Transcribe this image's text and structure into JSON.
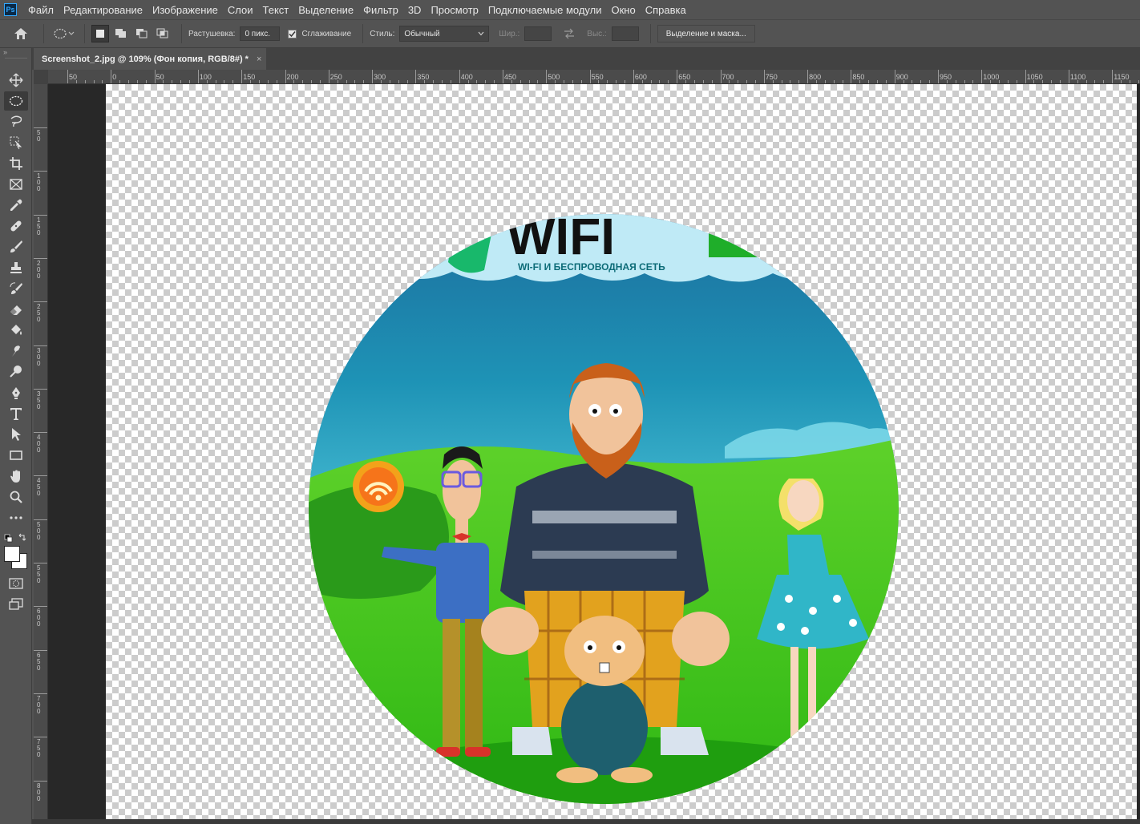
{
  "app": {
    "logo": "Ps"
  },
  "menu": [
    "Файл",
    "Редактирование",
    "Изображение",
    "Слои",
    "Текст",
    "Выделение",
    "Фильтр",
    "3D",
    "Просмотр",
    "Подключаемые модули",
    "Окно",
    "Справка"
  ],
  "options": {
    "feather_label": "Растушевка:",
    "feather_value": "0 пикс.",
    "antialias_label": "Сглаживание",
    "antialias_checked": true,
    "style_label": "Стиль:",
    "style_value": "Обычный",
    "width_label": "Шир.:",
    "height_label": "Выс.:",
    "select_mask_button": "Выделение и маска..."
  },
  "tools": [
    "move-tool",
    "elliptical-marquee-tool",
    "lasso-tool",
    "object-selection-tool",
    "crop-tool",
    "frame-tool",
    "eyedropper-tool",
    "healing-brush-tool",
    "brush-tool",
    "clone-stamp-tool",
    "history-brush-tool",
    "eraser-tool",
    "paint-bucket-tool",
    "smudge-tool",
    "dodge-tool",
    "pen-tool",
    "type-tool",
    "path-selection-tool",
    "rectangle-tool",
    "hand-tool",
    "zoom-tool",
    "more-tools",
    "quick-mask",
    "screen-mode"
  ],
  "document": {
    "tab_title": "Screenshot_2.jpg @ 109% (Фон копия, RGB/8#) *",
    "close_glyph": "×"
  },
  "ruler_h": [
    "50",
    "0",
    "50",
    "100",
    "150",
    "200",
    "250",
    "300",
    "350",
    "400",
    "450",
    "500",
    "550",
    "600",
    "650",
    "700",
    "750",
    "800",
    "850",
    "900",
    "950",
    "1000",
    "1050",
    "1100",
    "1150"
  ],
  "ruler_v": [
    "50",
    "100",
    "150",
    "200",
    "250",
    "300",
    "350",
    "400",
    "450",
    "500",
    "550",
    "600",
    "650",
    "700",
    "750",
    "800"
  ],
  "artwork": {
    "logo_text": "WIFI",
    "logo_subtitle": "WI-FI И БЕСПРОВОДНАЯ СЕТЬ"
  },
  "colors": {
    "accent": "#31a8ff",
    "ui_bg": "#535353",
    "workspace_bg": "#282828",
    "grass": "#3cc11e",
    "sky": "#1a8fb0",
    "logo_green": "#18b86b"
  }
}
